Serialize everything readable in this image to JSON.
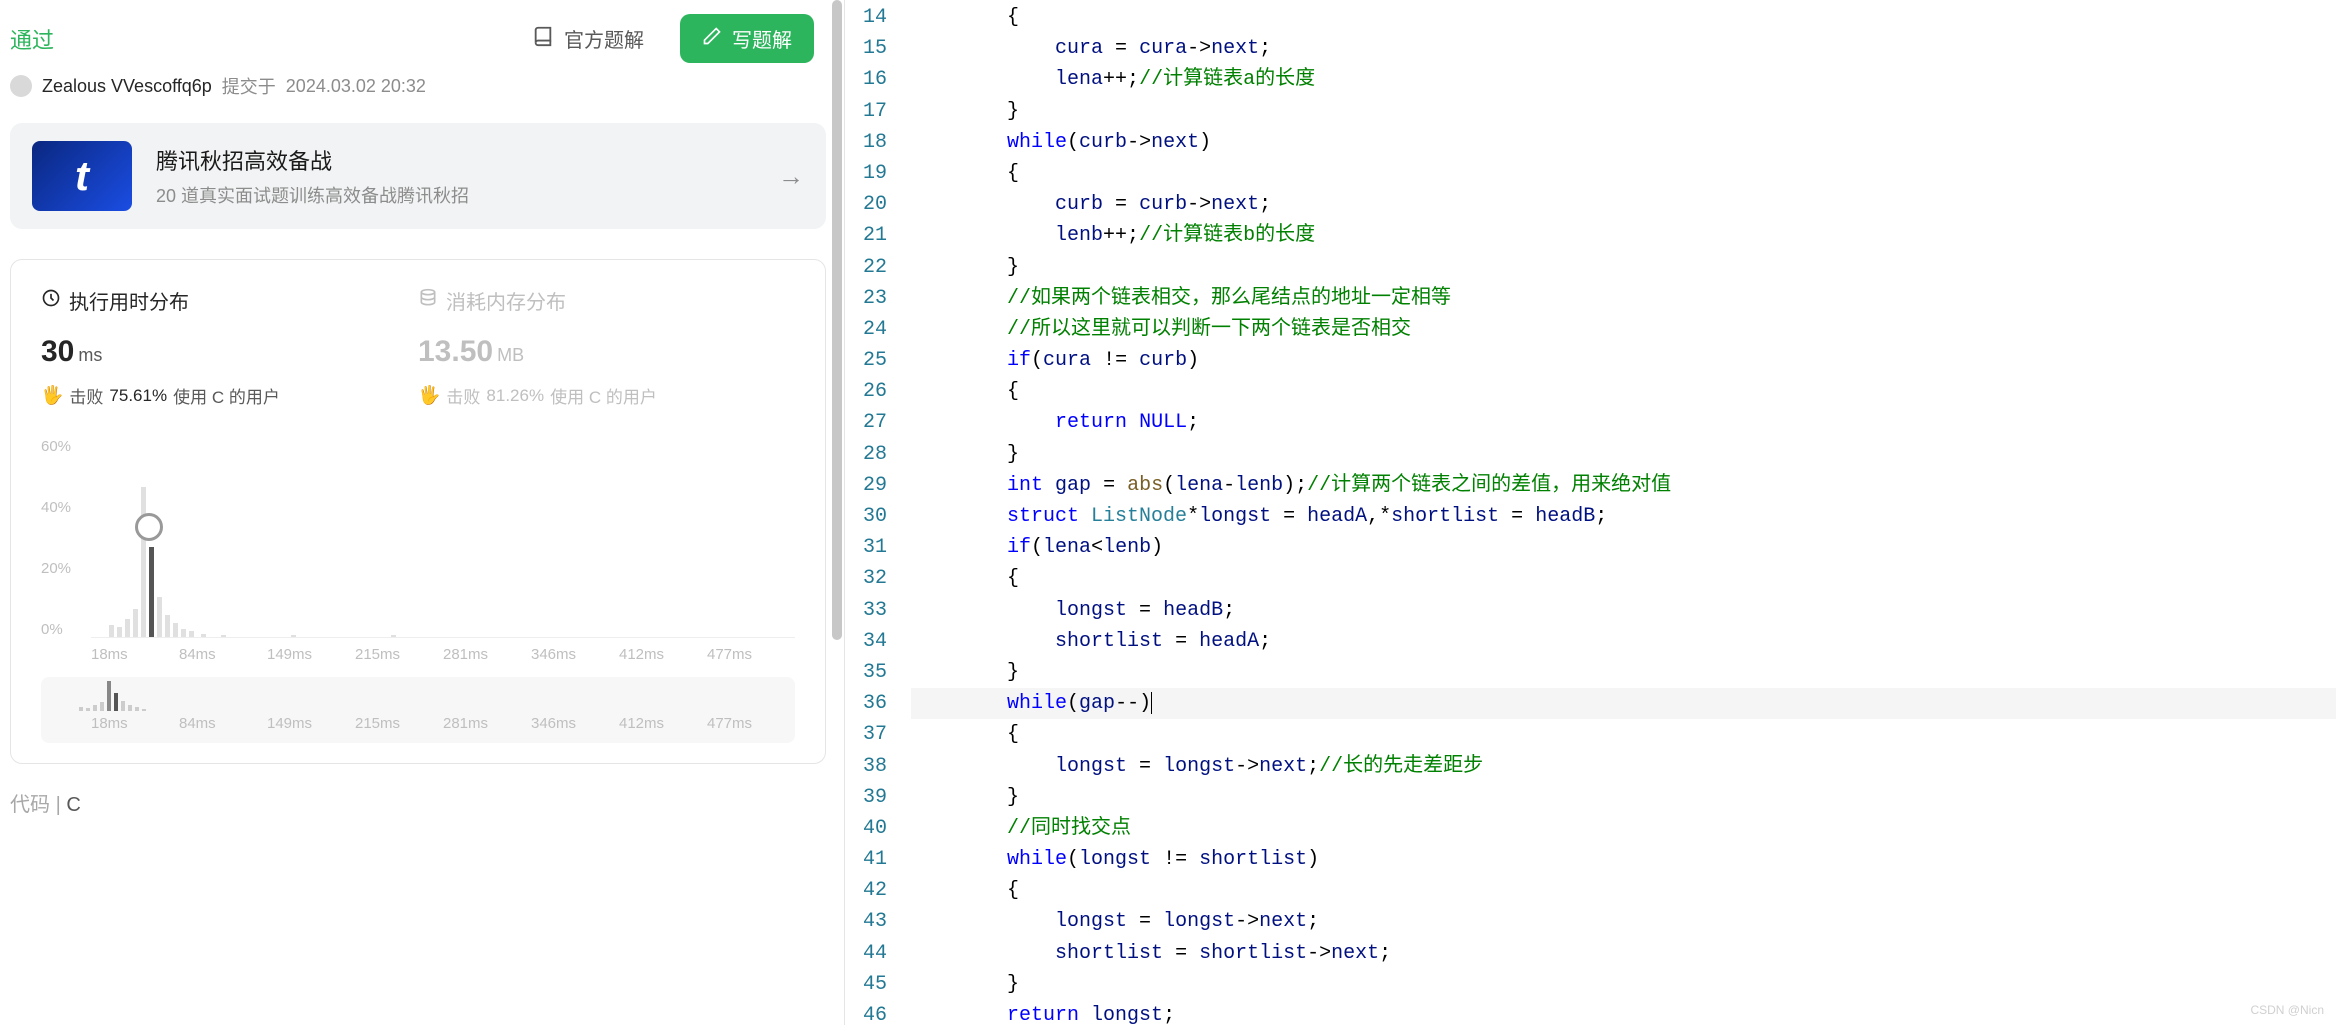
{
  "status": "通过",
  "author": {
    "name": "Zealous VVescoffq6p",
    "submit_prefix": "提交于",
    "submit_time": "2024.03.02 20:32"
  },
  "buttons": {
    "official": "官方题解",
    "write": "写题解"
  },
  "promo": {
    "title": "腾讯秋招高效备战",
    "subtitle": "20 道真实面试题训练高效备战腾讯秋招",
    "icon_letter": "t"
  },
  "stats": {
    "runtime": {
      "title": "执行用时分布",
      "value": "30",
      "unit": "ms",
      "beat_prefix": "击败",
      "beat_pct": "75.61%",
      "beat_suffix": "使用 C 的用户"
    },
    "memory": {
      "title": "消耗内存分布",
      "value": "13.50",
      "unit": "MB",
      "beat_prefix": "击败",
      "beat_pct": "81.26%",
      "beat_suffix": "使用 C 的用户"
    }
  },
  "chart_data": {
    "type": "bar",
    "ylabel_pct": [
      "60%",
      "40%",
      "20%",
      "0%"
    ],
    "x_ticks": [
      "18ms",
      "84ms",
      "149ms",
      "215ms",
      "281ms",
      "346ms",
      "412ms",
      "477ms"
    ],
    "mini_x_ticks": [
      "18ms",
      "84ms",
      "149ms",
      "215ms",
      "281ms",
      "346ms",
      "412ms",
      "477ms"
    ]
  },
  "code_section": {
    "label": "代码",
    "lang": "C"
  },
  "code": {
    "start_line": 14,
    "lines": [
      {
        "n": 14,
        "tokens": [
          [
            "br",
            "        {"
          ]
        ]
      },
      {
        "n": 15,
        "tokens": [
          [
            "pl",
            "            "
          ],
          [
            "var",
            "cura"
          ],
          [
            "op",
            " = "
          ],
          [
            "var",
            "cura"
          ],
          [
            "op",
            "->"
          ],
          [
            "var",
            "next"
          ],
          [
            "op",
            ";"
          ]
        ]
      },
      {
        "n": 16,
        "tokens": [
          [
            "pl",
            "            "
          ],
          [
            "var",
            "lena"
          ],
          [
            "op",
            "++;"
          ],
          [
            "cm",
            "//计算链表a的长度"
          ]
        ]
      },
      {
        "n": 17,
        "tokens": [
          [
            "br",
            "        }"
          ]
        ]
      },
      {
        "n": 18,
        "tokens": [
          [
            "pl",
            "        "
          ],
          [
            "kw",
            "while"
          ],
          [
            "op",
            "("
          ],
          [
            "var",
            "curb"
          ],
          [
            "op",
            "->"
          ],
          [
            "var",
            "next"
          ],
          [
            "op",
            ")"
          ]
        ]
      },
      {
        "n": 19,
        "tokens": [
          [
            "br",
            "        {"
          ]
        ]
      },
      {
        "n": 20,
        "tokens": [
          [
            "pl",
            "            "
          ],
          [
            "var",
            "curb"
          ],
          [
            "op",
            " = "
          ],
          [
            "var",
            "curb"
          ],
          [
            "op",
            "->"
          ],
          [
            "var",
            "next"
          ],
          [
            "op",
            ";"
          ]
        ]
      },
      {
        "n": 21,
        "tokens": [
          [
            "pl",
            "            "
          ],
          [
            "var",
            "lenb"
          ],
          [
            "op",
            "++;"
          ],
          [
            "cm",
            "//计算链表b的长度"
          ]
        ]
      },
      {
        "n": 22,
        "tokens": [
          [
            "br",
            "        }"
          ]
        ]
      },
      {
        "n": 23,
        "tokens": [
          [
            "pl",
            "        "
          ],
          [
            "cm",
            "//如果两个链表相交，那么尾结点的地址一定相等"
          ]
        ]
      },
      {
        "n": 24,
        "tokens": [
          [
            "pl",
            "        "
          ],
          [
            "cm",
            "//所以这里就可以判断一下两个链表是否相交"
          ]
        ]
      },
      {
        "n": 25,
        "tokens": [
          [
            "pl",
            "        "
          ],
          [
            "kw",
            "if"
          ],
          [
            "op",
            "("
          ],
          [
            "var",
            "cura"
          ],
          [
            "op",
            " != "
          ],
          [
            "var",
            "curb"
          ],
          [
            "op",
            ")"
          ]
        ]
      },
      {
        "n": 26,
        "tokens": [
          [
            "br",
            "        {"
          ]
        ]
      },
      {
        "n": 27,
        "tokens": [
          [
            "pl",
            "            "
          ],
          [
            "kw",
            "return"
          ],
          [
            "pl",
            " "
          ],
          [
            "nl",
            "NULL"
          ],
          [
            "op",
            ";"
          ]
        ]
      },
      {
        "n": 28,
        "tokens": [
          [
            "br",
            "        }"
          ]
        ]
      },
      {
        "n": 29,
        "tokens": [
          [
            "pl",
            "        "
          ],
          [
            "kw",
            "int"
          ],
          [
            "pl",
            " "
          ],
          [
            "var",
            "gap"
          ],
          [
            "op",
            " = "
          ],
          [
            "fn",
            "abs"
          ],
          [
            "op",
            "("
          ],
          [
            "var",
            "lena"
          ],
          [
            "op",
            "-"
          ],
          [
            "var",
            "lenb"
          ],
          [
            "op",
            ");"
          ],
          [
            "cm",
            "//计算两个链表之间的差值，用来绝对值"
          ]
        ]
      },
      {
        "n": 30,
        "tokens": [
          [
            "pl",
            "        "
          ],
          [
            "kw",
            "struct"
          ],
          [
            "pl",
            " "
          ],
          [
            "ty",
            "ListNode"
          ],
          [
            "op",
            "*"
          ],
          [
            "var",
            "longst"
          ],
          [
            "op",
            " = "
          ],
          [
            "var",
            "headA"
          ],
          [
            "op",
            ",*"
          ],
          [
            "var",
            "shortlist"
          ],
          [
            "op",
            " = "
          ],
          [
            "var",
            "headB"
          ],
          [
            "op",
            ";"
          ]
        ]
      },
      {
        "n": 31,
        "tokens": [
          [
            "pl",
            "        "
          ],
          [
            "kw",
            "if"
          ],
          [
            "op",
            "("
          ],
          [
            "var",
            "lena"
          ],
          [
            "op",
            "<"
          ],
          [
            "var",
            "lenb"
          ],
          [
            "op",
            ")"
          ]
        ]
      },
      {
        "n": 32,
        "tokens": [
          [
            "br",
            "        {"
          ]
        ]
      },
      {
        "n": 33,
        "tokens": [
          [
            "pl",
            "            "
          ],
          [
            "var",
            "longst"
          ],
          [
            "op",
            " = "
          ],
          [
            "var",
            "headB"
          ],
          [
            "op",
            ";"
          ]
        ]
      },
      {
        "n": 34,
        "tokens": [
          [
            "pl",
            "            "
          ],
          [
            "var",
            "shortlist"
          ],
          [
            "op",
            " = "
          ],
          [
            "var",
            "headA"
          ],
          [
            "op",
            ";"
          ]
        ]
      },
      {
        "n": 35,
        "tokens": [
          [
            "br",
            "        }"
          ]
        ]
      },
      {
        "n": 36,
        "hl": true,
        "tokens": [
          [
            "pl",
            "        "
          ],
          [
            "kw",
            "while"
          ],
          [
            "op",
            "("
          ],
          [
            "var",
            "gap"
          ],
          [
            "op",
            "--)"
          ],
          [
            "caret",
            ""
          ]
        ]
      },
      {
        "n": 37,
        "tokens": [
          [
            "br",
            "        {"
          ]
        ]
      },
      {
        "n": 38,
        "tokens": [
          [
            "pl",
            "            "
          ],
          [
            "var",
            "longst"
          ],
          [
            "op",
            " = "
          ],
          [
            "var",
            "longst"
          ],
          [
            "op",
            "->"
          ],
          [
            "var",
            "next"
          ],
          [
            "op",
            ";"
          ],
          [
            "cm",
            "//长的先走差距步"
          ]
        ]
      },
      {
        "n": 39,
        "tokens": [
          [
            "br",
            "        }"
          ]
        ]
      },
      {
        "n": 40,
        "tokens": [
          [
            "pl",
            "        "
          ],
          [
            "cm",
            "//同时找交点"
          ]
        ]
      },
      {
        "n": 41,
        "tokens": [
          [
            "pl",
            "        "
          ],
          [
            "kw",
            "while"
          ],
          [
            "op",
            "("
          ],
          [
            "var",
            "longst"
          ],
          [
            "op",
            " != "
          ],
          [
            "var",
            "shortlist"
          ],
          [
            "op",
            ")"
          ]
        ]
      },
      {
        "n": 42,
        "tokens": [
          [
            "br",
            "        {"
          ]
        ]
      },
      {
        "n": 43,
        "tokens": [
          [
            "pl",
            "            "
          ],
          [
            "var",
            "longst"
          ],
          [
            "op",
            " = "
          ],
          [
            "var",
            "longst"
          ],
          [
            "op",
            "->"
          ],
          [
            "var",
            "next"
          ],
          [
            "op",
            ";"
          ]
        ]
      },
      {
        "n": 44,
        "tokens": [
          [
            "pl",
            "            "
          ],
          [
            "var",
            "shortlist"
          ],
          [
            "op",
            " = "
          ],
          [
            "var",
            "shortlist"
          ],
          [
            "op",
            "->"
          ],
          [
            "var",
            "next"
          ],
          [
            "op",
            ";"
          ]
        ]
      },
      {
        "n": 45,
        "tokens": [
          [
            "br",
            "        }"
          ]
        ]
      },
      {
        "n": 46,
        "tokens": [
          [
            "pl",
            "        "
          ],
          [
            "kw",
            "return"
          ],
          [
            "pl",
            " "
          ],
          [
            "var",
            "longst"
          ],
          [
            "op",
            ";"
          ]
        ]
      }
    ]
  },
  "watermark": "CSDN @Nicn"
}
